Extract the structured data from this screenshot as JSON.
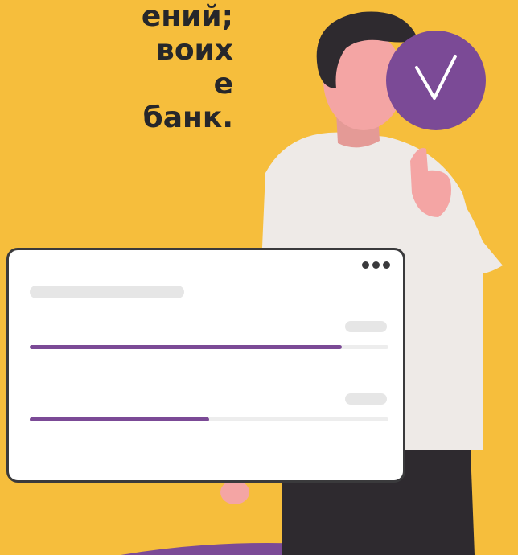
{
  "headline": {
    "lines": [
      "ений;",
      "воих",
      "е",
      "банк."
    ]
  },
  "progress": [
    {
      "fraction": 0.87
    },
    {
      "fraction": 0.5
    }
  ],
  "colors": {
    "background": "#F6BE3C",
    "accent": "#7B4A96",
    "text": "#26272B",
    "card_border": "#3A3A3C"
  },
  "icons": {
    "badge": "checkmark-icon",
    "menu": "more-dots-icon"
  }
}
